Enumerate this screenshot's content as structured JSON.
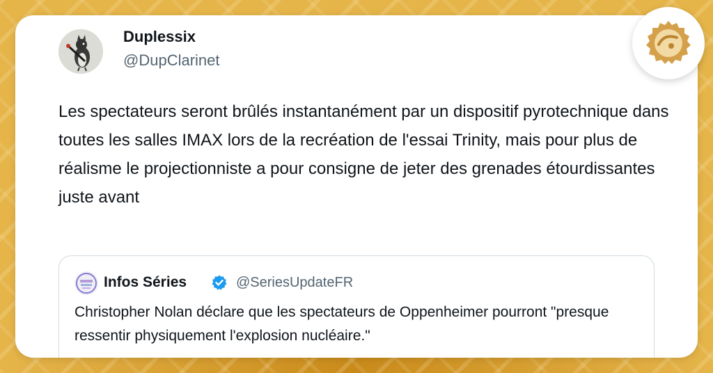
{
  "tweet": {
    "author": {
      "display_name": "Duplessix",
      "handle": "@DupClarinet"
    },
    "text": "Les spectateurs seront brûlés instantanément par un dispositif pyrotechnique dans toutes les salles IMAX lors de la recréation de l'essai Trinity, mais pour plus de réalisme le projectionniste a pour consigne de jeter des grenades étourdissantes juste avant",
    "quoted": {
      "display_name": "Infos Séries",
      "handle": "@SeriesUpdateFR",
      "verified_icon": "verified-badge-icon",
      "text": "Christopher Nolan déclare que les spectateurs de Oppenheimer pourront \"presque ressentir physiquement l'explosion nucléaire.\""
    }
  },
  "colors": {
    "background": "#e5b54a",
    "card": "#ffffff",
    "text_primary": "#0f1419",
    "text_secondary": "#536471",
    "verified_blue": "#1d9bf0",
    "logo_gold": "#d4a04a"
  },
  "icons": {
    "avatar": "bird-clarinet-avatar",
    "quote_avatar": "series-logo-avatar",
    "brand_logo": "brand-logo-icon"
  }
}
